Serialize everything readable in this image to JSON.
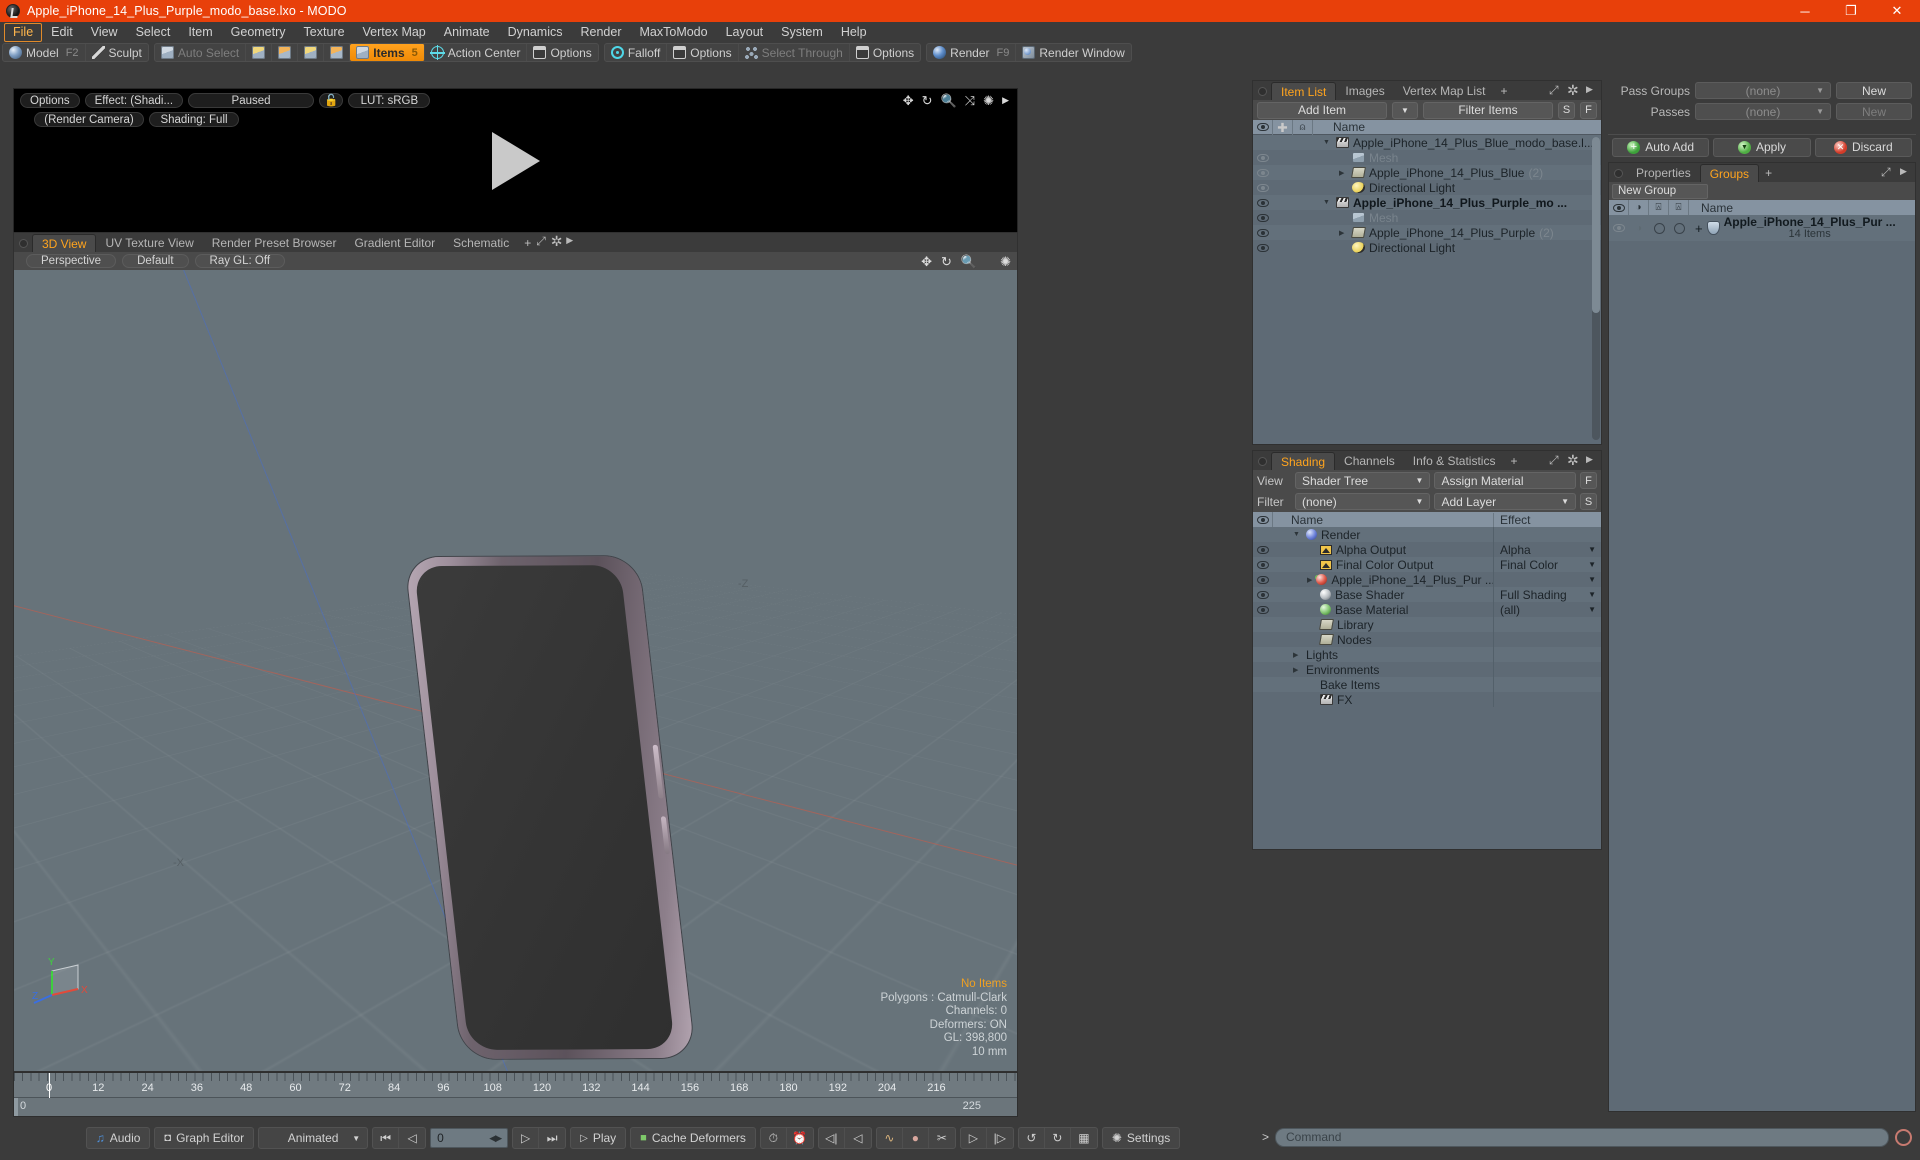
{
  "window": {
    "title": "Apple_iPhone_14_Plus_Purple_modo_base.lxo - MODO",
    "minimize": "─",
    "maximize": "❐",
    "close": "✕"
  },
  "menubar": {
    "items": [
      "File",
      "Edit",
      "View",
      "Select",
      "Item",
      "Geometry",
      "Texture",
      "Vertex Map",
      "Animate",
      "Dynamics",
      "Render",
      "MaxToModo",
      "Layout",
      "System",
      "Help"
    ],
    "active": "File"
  },
  "toolbar": {
    "mode_model": "Model",
    "mode_model_hint": "F2",
    "mode_sculpt": "Sculpt",
    "auto_select": "Auto Select",
    "items": "Items",
    "items_hint": "5",
    "action_center": "Action Center",
    "options1": "Options",
    "falloff": "Falloff",
    "options2": "Options",
    "select_through": "Select Through",
    "options3": "Options",
    "render": "Render",
    "render_hint": "F9",
    "render_window": "Render Window"
  },
  "render_preview": {
    "options": "Options",
    "effect": "Effect: (Shadi...",
    "paused": "Paused",
    "lut": "LUT: sRGB",
    "camera": "(Render Camera)",
    "shading": "Shading: Full"
  },
  "viewport": {
    "tabs": [
      "3D View",
      "UV Texture View",
      "Render Preset Browser",
      "Gradient Editor",
      "Schematic"
    ],
    "active_tab": "3D View",
    "add_tab": "+",
    "perspective": "Perspective",
    "preset": "Default",
    "raygl": "Ray GL: Off",
    "axis_neg_x": "-X",
    "axis_neg_z": "-Z",
    "gizmo_x": "X",
    "gizmo_y": "Y",
    "gizmo_z": "Z",
    "stats": {
      "no_items": "No Items",
      "polygons": "Polygons : Catmull-Clark",
      "channels": "Channels: 0",
      "deformers": "Deformers: ON",
      "gl": "GL: 398,800",
      "scale": "10 mm"
    }
  },
  "timeline": {
    "labels": [
      "0",
      "12",
      "24",
      "36",
      "48",
      "60",
      "72",
      "84",
      "96",
      "108",
      "120",
      "132",
      "144",
      "156",
      "168",
      "180",
      "192",
      "204",
      "216"
    ],
    "range_start": "0",
    "range_end": "225",
    "playhead": "0"
  },
  "bottombar": {
    "audio": "Audio",
    "graph_editor": "Graph Editor",
    "animated": "Animated",
    "frame_value": "0",
    "play": "Play",
    "cache_deformers": "Cache Deformers",
    "settings": "Settings",
    "first": "⏮",
    "prev": "◁",
    "next": "▷",
    "last": "⏭"
  },
  "item_list": {
    "tabs": [
      "Item List",
      "Images",
      "Vertex Map List"
    ],
    "active_tab": "Item List",
    "add_tab": "+",
    "add_item": "Add Item",
    "filter_items": "Filter Items",
    "btn_s": "S",
    "btn_f": "F",
    "col_name": "Name",
    "rows": [
      {
        "label": "Apple_iPhone_14_Plus_Blue_modo_base.l...",
        "icon": "clap",
        "indent": 0,
        "eye": "none",
        "tri": "▼",
        "bold": false,
        "dim": false,
        "count": ""
      },
      {
        "label": "Mesh",
        "icon": "mesh",
        "indent": 1,
        "eye": "dim",
        "tri": "",
        "bold": false,
        "dim": true,
        "count": ""
      },
      {
        "label": "Apple_iPhone_14_Plus_Blue",
        "icon": "folder",
        "indent": 1,
        "eye": "dim",
        "tri": "▶",
        "bold": false,
        "dim": false,
        "count": "(2)"
      },
      {
        "label": "Directional Light",
        "icon": "light",
        "indent": 1,
        "eye": "dim",
        "tri": "",
        "bold": false,
        "dim": false,
        "count": ""
      },
      {
        "label": "Apple_iPhone_14_Plus_Purple_mo ...",
        "icon": "clap",
        "indent": 0,
        "eye": "on",
        "tri": "▼",
        "bold": true,
        "dim": false,
        "count": ""
      },
      {
        "label": "Mesh",
        "icon": "mesh",
        "indent": 1,
        "eye": "on",
        "tri": "",
        "bold": false,
        "dim": true,
        "count": ""
      },
      {
        "label": "Apple_iPhone_14_Plus_Purple",
        "icon": "folder",
        "indent": 1,
        "eye": "on",
        "tri": "▶",
        "bold": false,
        "dim": false,
        "count": "(2)"
      },
      {
        "label": "Directional Light",
        "icon": "light",
        "indent": 1,
        "eye": "on",
        "tri": "",
        "bold": false,
        "dim": false,
        "count": ""
      }
    ]
  },
  "shading": {
    "tabs": [
      "Shading",
      "Channels",
      "Info & Statistics"
    ],
    "active_tab": "Shading",
    "add_tab": "+",
    "view_label": "View",
    "view_value": "Shader Tree",
    "assign_material": "Assign Material",
    "btn_f": "F",
    "filter_label": "Filter",
    "filter_value": "(none)",
    "add_layer": "Add Layer",
    "btn_s": "S",
    "col_name": "Name",
    "col_effect": "Effect",
    "rows": [
      {
        "label": "Render",
        "effect": "",
        "icon": "sphere-blue",
        "indent": 1,
        "eye": "none",
        "tri": "▼",
        "caret": false
      },
      {
        "label": "Alpha Output",
        "effect": "Alpha",
        "icon": "image",
        "indent": 2,
        "eye": "on",
        "tri": "",
        "caret": true
      },
      {
        "label": "Final Color Output",
        "effect": "Final Color",
        "icon": "image",
        "indent": 2,
        "eye": "on",
        "tri": "",
        "caret": true
      },
      {
        "label": "Apple_iPhone_14_Plus_Pur ...",
        "effect": "",
        "icon": "sphere-red",
        "indent": 2,
        "eye": "on",
        "tri": "▶",
        "caret": true
      },
      {
        "label": "Base Shader",
        "effect": "Full Shading",
        "icon": "sphere-gray",
        "indent": 2,
        "eye": "on",
        "tri": "",
        "caret": true
      },
      {
        "label": "Base Material",
        "effect": "(all)",
        "icon": "sphere-green",
        "indent": 2,
        "eye": "on",
        "tri": "",
        "caret": true
      },
      {
        "label": "Library",
        "effect": "",
        "icon": "folder",
        "indent": 2,
        "eye": "none",
        "tri": "",
        "caret": false
      },
      {
        "label": "Nodes",
        "effect": "",
        "icon": "folder",
        "indent": 2,
        "eye": "none",
        "tri": "",
        "caret": false
      },
      {
        "label": "Lights",
        "effect": "",
        "icon": "none",
        "indent": 1,
        "eye": "none",
        "tri": "▶",
        "caret": false
      },
      {
        "label": "Environments",
        "effect": "",
        "icon": "none",
        "indent": 1,
        "eye": "none",
        "tri": "▶",
        "caret": false
      },
      {
        "label": "Bake Items",
        "effect": "",
        "icon": "none",
        "indent": 2,
        "eye": "none",
        "tri": "",
        "caret": false
      },
      {
        "label": "FX",
        "effect": "",
        "icon": "clap",
        "indent": 2,
        "eye": "none",
        "tri": "",
        "caret": false
      }
    ]
  },
  "passes": {
    "pass_groups_label": "Pass Groups",
    "pass_groups_value": "(none)",
    "pass_groups_new": "New",
    "passes_label": "Passes",
    "passes_value": "(none)",
    "passes_new": "New",
    "auto_add": "Auto Add",
    "apply": "Apply",
    "discard": "Discard"
  },
  "groups": {
    "tabs": [
      "Properties",
      "Groups"
    ],
    "active_tab": "Groups",
    "add_tab": "+",
    "new_group": "New Group",
    "col_name": "Name",
    "row_label": "Apple_iPhone_14_Plus_Pur ...",
    "row_sub": "14 Items",
    "row_plus": "+"
  },
  "command": {
    "caret": ">",
    "placeholder": "Command"
  },
  "colors": {
    "accent": "#ffa41e",
    "titlebar": "#e8400a",
    "panel": "#4a4a4a",
    "list": "#5e6a75",
    "viewport": "#67737a"
  }
}
